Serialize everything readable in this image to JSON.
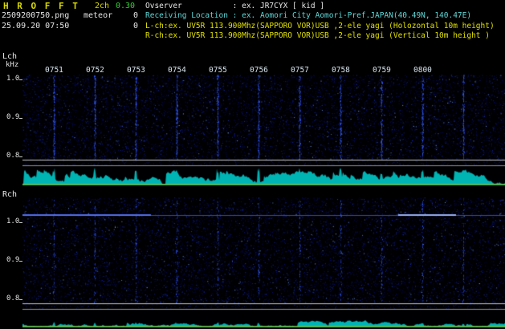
{
  "app": {
    "title": "H R O F F T",
    "mode": "2ch",
    "version": "0.30",
    "filename": "2509200750.png",
    "meteor_label": "meteor",
    "count_top": "0",
    "count_bottom": "0",
    "datetime": "25.09.20 07:50"
  },
  "header": {
    "observer": "Ovserver           : ex. JR7CYX [ kid ]",
    "location": "Receiving Location : ex. Aomori City Aomori-Pref.JAPAN(40.49N, 140.47E)",
    "lch_config": "L-ch:ex. UV5R 113.900Mhz(SAPPORO VOR)USB ,2-ele yagi (Holozontal 10m height)",
    "rch_config": "R-ch:ex. UV5R 113.900Mhz(SAPPORO VOR)USB ,2-ele yagi (Vertical 10m height )"
  },
  "chart_data": [
    {
      "type": "heatmap",
      "title": "L-ch meteor-echo spectrogram with signal-level trace",
      "channel": "Lch",
      "ylabel": "kHz",
      "x_tick_labels": [
        "0751",
        "0752",
        "0753",
        "0754",
        "0755",
        "0756",
        "0757",
        "0758",
        "0759",
        "0800"
      ],
      "y_tick_labels": [
        "1.0",
        "0.9",
        "0.8"
      ],
      "y_range_khz": [
        0.78,
        1.02
      ],
      "x_range_time": [
        "07:50",
        "08:00"
      ],
      "grid": "vertical dotted minute-marker columns in spectrogram",
      "legend": "none",
      "meteor_count": 0,
      "features": [
        "uniform dark-blue background noise speckle",
        "no meteor echoes visible",
        "two light horizontal divider lines near 0.8 kHz",
        "jagged cyan signal-level trace along bottom strip with spikes at each minute mark",
        "dim yellow threshold line through level strip"
      ]
    },
    {
      "type": "heatmap",
      "title": "R-ch meteor-echo spectrogram with signal-level trace",
      "channel": "Rch",
      "ylabel": "",
      "x_tick_labels": [],
      "y_tick_labels": [
        "1.0",
        "0.9",
        "0.8"
      ],
      "y_range_khz": [
        0.78,
        1.02
      ],
      "x_range_time": [
        "07:50",
        "08:00"
      ],
      "grid": "faint minute-marker columns",
      "legend": "none",
      "meteor_count": 0,
      "features": [
        "bright continuous blue carrier line at ~1.02 kHz across full width",
        "uniform dark-blue background noise speckle",
        "two light horizontal divider lines near 0.8 kHz",
        "low flat cyan signal-level trace along bottom strip",
        "dim yellow threshold line through level strip"
      ]
    }
  ],
  "colors": {
    "background": "#000000",
    "noise_blue": "#2030c0",
    "carrier_blue": "#3c5aff",
    "trace_cyan": "#00b4b4",
    "divider_gray": "#c9c9c9",
    "threshold_yellow": "#b8b800",
    "title_yellow": "#d9d900",
    "version_green": "#33cc33",
    "info_cyan": "#5fd7d7",
    "config_yellow": "#e0e000",
    "text_white": "#e6e6e6"
  }
}
